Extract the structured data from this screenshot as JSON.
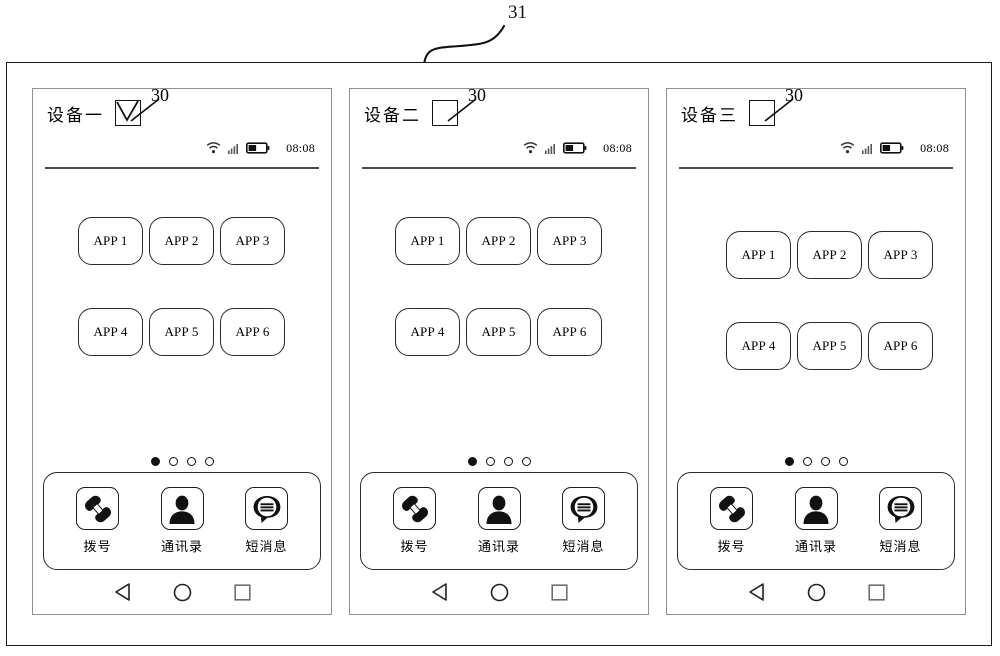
{
  "figure": {
    "outer_ref_label": "31",
    "checkbox_ref_label": "30"
  },
  "devices": [
    {
      "name": "设备一",
      "checked": true,
      "status": {
        "wifi_icon": "wifi-icon",
        "signal_icon": "signal-bars-icon",
        "battery_icon": "battery-icon",
        "time": "08:08"
      },
      "apps": [
        "APP 1",
        "APP 2",
        "APP 3",
        "APP 4",
        "APP 5",
        "APP 6"
      ],
      "page_dots": {
        "count": 4,
        "active_index": 0
      },
      "dock": [
        {
          "icon": "phone-handset-icon",
          "label": "拨号"
        },
        {
          "icon": "contacts-person-icon",
          "label": "通讯录"
        },
        {
          "icon": "message-bubble-icon",
          "label": "短消息"
        }
      ],
      "nav": [
        {
          "icon": "back-triangle-icon"
        },
        {
          "icon": "home-circle-icon"
        },
        {
          "icon": "recents-square-icon"
        }
      ]
    },
    {
      "name": "设备二",
      "checked": false,
      "status": {
        "wifi_icon": "wifi-icon",
        "signal_icon": "signal-bars-icon",
        "battery_icon": "battery-icon",
        "time": "08:08"
      },
      "apps": [
        "APP 1",
        "APP 2",
        "APP 3",
        "APP 4",
        "APP 5",
        "APP 6"
      ],
      "page_dots": {
        "count": 4,
        "active_index": 0
      },
      "dock": [
        {
          "icon": "phone-handset-icon",
          "label": "拨号"
        },
        {
          "icon": "contacts-person-icon",
          "label": "通讯录"
        },
        {
          "icon": "message-bubble-icon",
          "label": "短消息"
        }
      ],
      "nav": [
        {
          "icon": "back-triangle-icon"
        },
        {
          "icon": "home-circle-icon"
        },
        {
          "icon": "recents-square-icon"
        }
      ]
    },
    {
      "name": "设备三",
      "checked": false,
      "status": {
        "wifi_icon": "wifi-icon",
        "signal_icon": "signal-bars-icon",
        "battery_icon": "battery-icon",
        "time": "08:08"
      },
      "apps": [
        "APP 1",
        "APP 2",
        "APP 3",
        "APP 4",
        "APP 5",
        "APP 6"
      ],
      "page_dots": {
        "count": 4,
        "active_index": 0
      },
      "dock": [
        {
          "icon": "phone-handset-icon",
          "label": "拨号"
        },
        {
          "icon": "contacts-person-icon",
          "label": "通讯录"
        },
        {
          "icon": "message-bubble-icon",
          "label": "短消息"
        }
      ],
      "nav": [
        {
          "icon": "back-triangle-icon"
        },
        {
          "icon": "home-circle-icon"
        },
        {
          "icon": "recents-square-icon"
        }
      ]
    }
  ],
  "colors": {
    "ink": "#111111",
    "panel_border": "#8d8f93",
    "divider": "#4a4a4e"
  }
}
